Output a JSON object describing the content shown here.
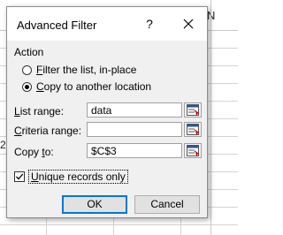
{
  "background": {
    "column_header_letter": "N",
    "row_peek_text": "2("
  },
  "dialog": {
    "title": "Advanced Filter",
    "help_glyph": "?",
    "close_glyph": "✕",
    "action": {
      "label": "Action",
      "options": [
        {
          "prefix": "",
          "mnemonic": "F",
          "rest": "ilter the list, in-place",
          "checked": false
        },
        {
          "prefix": "",
          "mnemonic": "C",
          "rest": "opy to another location",
          "checked": true
        }
      ]
    },
    "fields": [
      {
        "label_prefix": "",
        "mnemonic": "L",
        "label_rest": "ist range:",
        "value": "data"
      },
      {
        "label_prefix": "",
        "mnemonic": "C",
        "label_rest": "riteria range:",
        "value": ""
      },
      {
        "label_prefix": "Copy ",
        "mnemonic": "t",
        "label_rest": "o:",
        "value": "$C$3"
      }
    ],
    "unique_records": {
      "prefix": "",
      "mnemonic": "U",
      "rest": "nique records only",
      "checked": true
    },
    "ok_label": "OK",
    "cancel_label": "Cancel"
  },
  "colors": {
    "default_button_border": "#0078d7",
    "dialog_bg": "#f0f0f0"
  }
}
